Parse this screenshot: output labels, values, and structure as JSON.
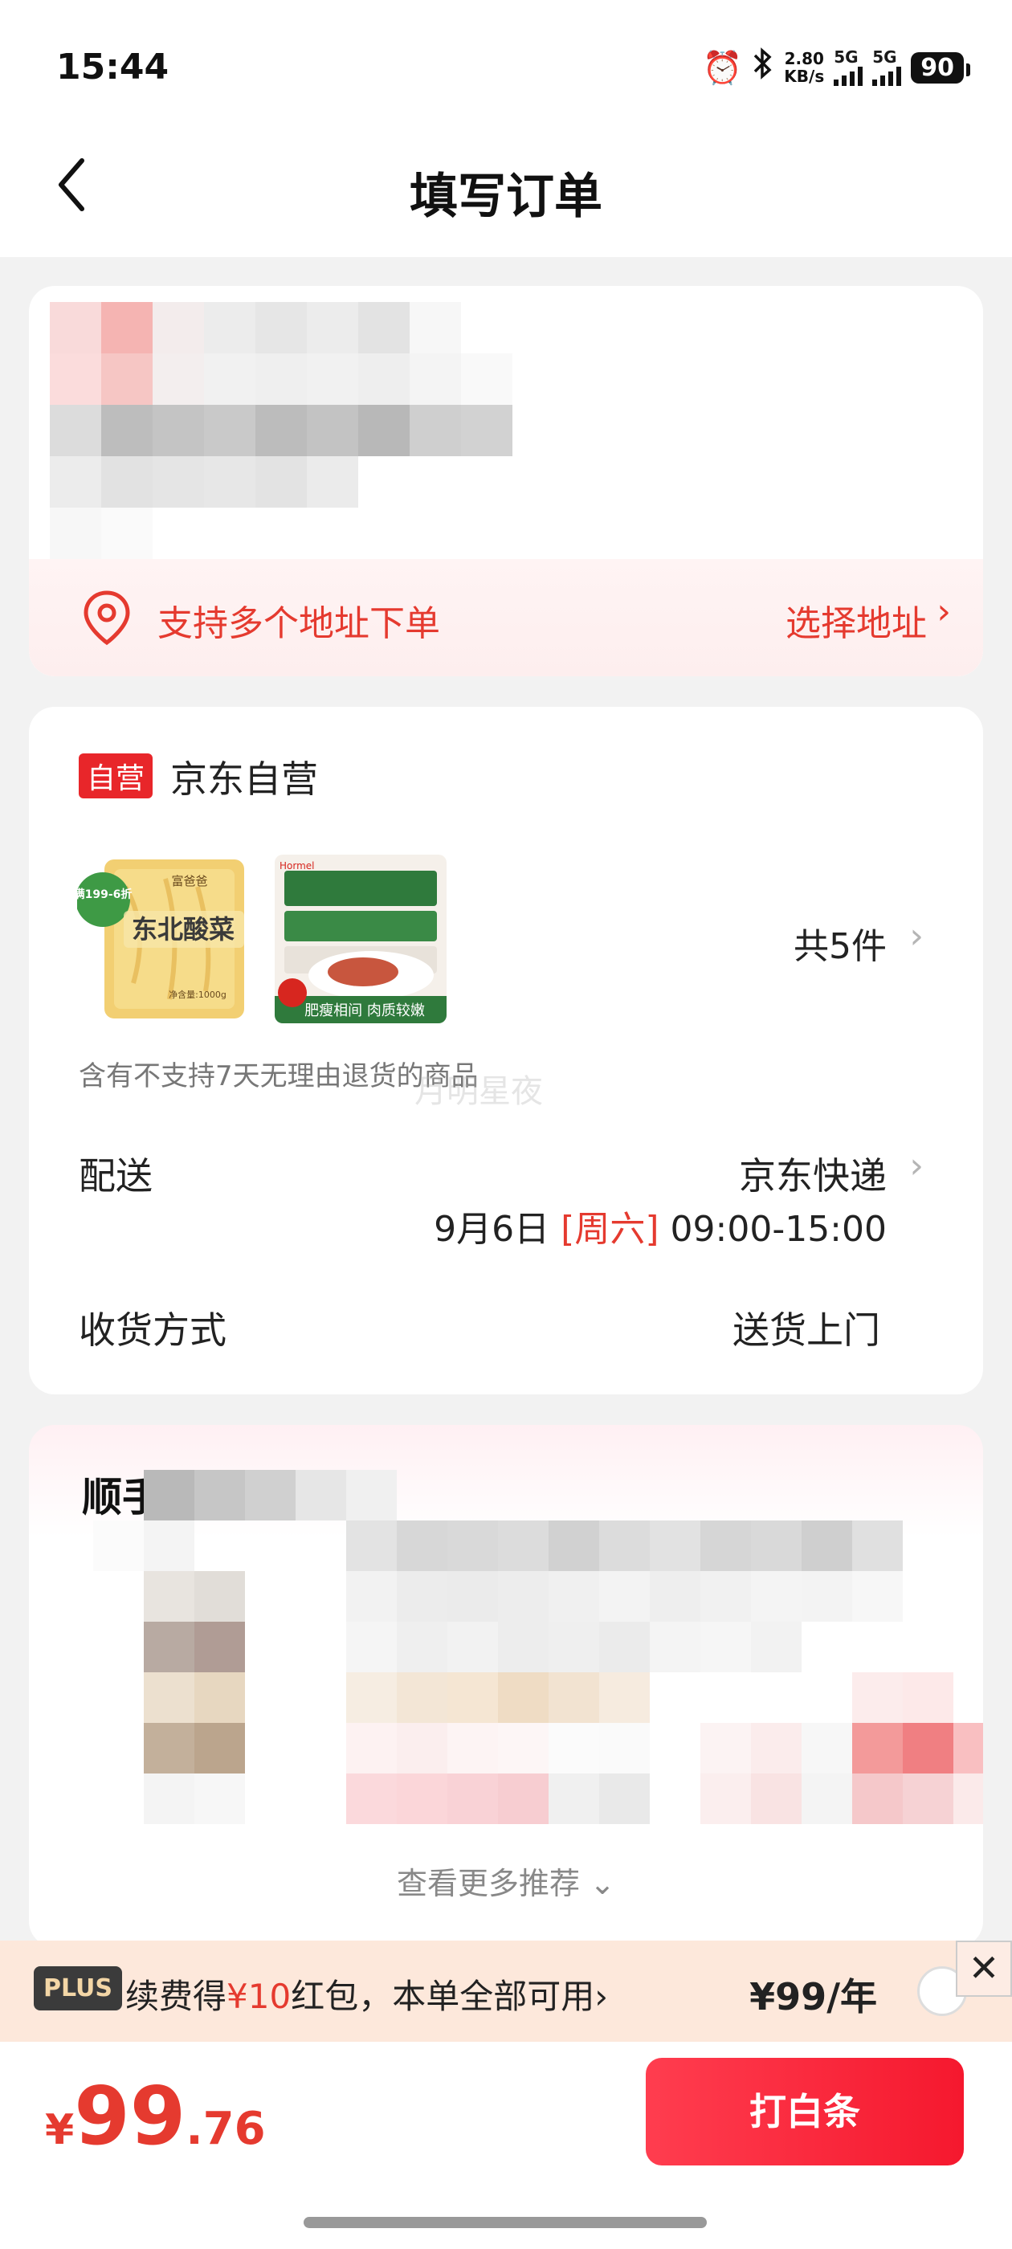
{
  "status_bar": {
    "time": "15:44",
    "net_speed_value": "2.80",
    "net_speed_unit": "KB/s",
    "signal_1": "5G",
    "signal_2": "5G",
    "battery": "90",
    "icons": [
      "alarm-icon",
      "bluetooth-icon",
      "signal-icon",
      "battery-icon"
    ]
  },
  "header": {
    "title": "填写订单",
    "back_icon": "chevron-left-icon"
  },
  "address": {
    "multi_label": "支持多个地址下单",
    "choose_label": "选择地址",
    "arrow": "›",
    "pin_icon": "location-pin-icon",
    "accent": "#e53a2f"
  },
  "order": {
    "badge": "自营",
    "shop": "京东自营",
    "product_1": {
      "promo": "满199-6折",
      "name": "东北酸菜",
      "brand": "富爸爸",
      "weight": "净含量:1000g"
    },
    "product_2": {
      "brand": "Hormel",
      "caption": "肥瘦相间 肉质较嫩"
    },
    "count": "共5件",
    "chevron": "›",
    "return_note": "含有不支持7天无理由退货的商品",
    "watermark": "月明星夜",
    "delivery_label": "配送",
    "delivery_carrier": "京东快递",
    "delivery_day": "9月6日",
    "delivery_weekday": "[周六]",
    "delivery_time": "09:00-15:00",
    "receive_label": "收货方式",
    "receive_value": "送货上门"
  },
  "recommend": {
    "title": "顺手买更优惠",
    "more": "查看更多推荐 ⌄"
  },
  "plus": {
    "badge": "PLUS",
    "text_before": "续费得",
    "text_amount": "¥10",
    "text_after": "红包，本单全部可用",
    "arrow": "›",
    "price": "¥99/年",
    "close": "✕"
  },
  "bottom": {
    "currency": "¥",
    "price_int": "99",
    "price_dec": ".76",
    "pay_label": "打白条",
    "brand_color": "#f5182e"
  }
}
